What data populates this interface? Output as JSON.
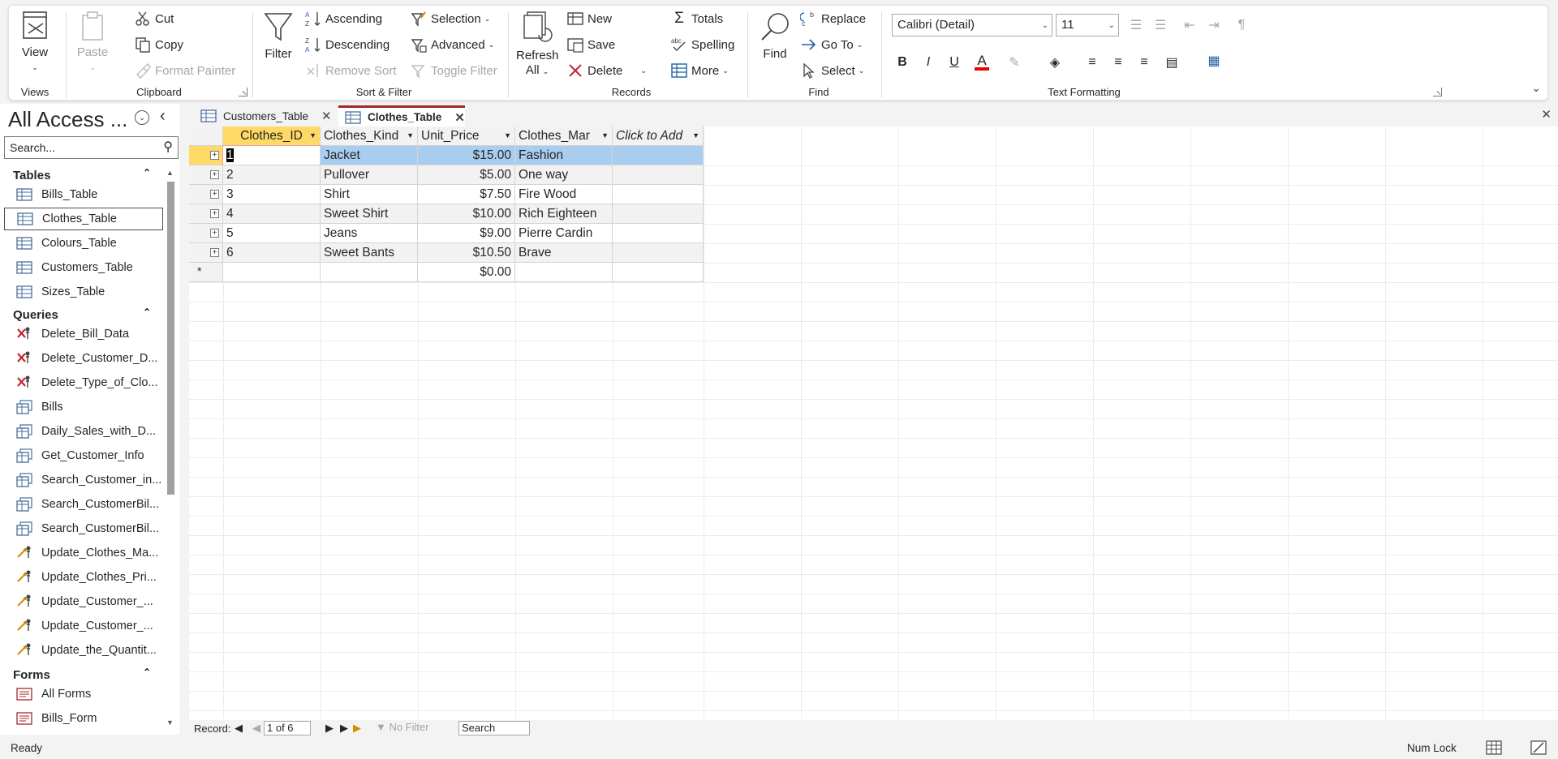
{
  "ribbon": {
    "views": {
      "view_label": "View",
      "group_label": "Views"
    },
    "clipboard": {
      "paste_label": "Paste",
      "cut_label": "Cut",
      "copy_label": "Copy",
      "format_painter_label": "Format Painter",
      "group_label": "Clipboard"
    },
    "sort_filter": {
      "filter_label": "Filter",
      "ascending_label": "Ascending",
      "descending_label": "Descending",
      "remove_sort_label": "Remove Sort",
      "selection_label": "Selection",
      "advanced_label": "Advanced",
      "toggle_filter_label": "Toggle Filter",
      "group_label": "Sort & Filter"
    },
    "records": {
      "refresh_label": "Refresh",
      "refresh_sub": "All",
      "new_label": "New",
      "save_label": "Save",
      "delete_label": "Delete",
      "totals_label": "Totals",
      "spelling_label": "Spelling",
      "more_label": "More",
      "group_label": "Records"
    },
    "find": {
      "find_label": "Find",
      "replace_label": "Replace",
      "goto_label": "Go To",
      "select_label": "Select",
      "group_label": "Find"
    },
    "text_formatting": {
      "font_value": "Calibri (Detail)",
      "size_value": "11",
      "bold": "B",
      "italic": "I",
      "underline": "U",
      "group_label": "Text Formatting"
    }
  },
  "nav": {
    "title": "All Access ...",
    "search_placeholder": "Search...",
    "sections": {
      "tables": {
        "label": "Tables",
        "items": [
          "Bills_Table",
          "Clothes_Table",
          "Colours_Table",
          "Customers_Table",
          "Sizes_Table"
        ]
      },
      "queries": {
        "label": "Queries",
        "items": [
          "Delete_Bill_Data",
          "Delete_Customer_D...",
          "Delete_Type_of_Clo...",
          "Bills",
          "Daily_Sales_with_D...",
          "Get_Customer_Info",
          "Search_Customer_in...",
          "Search_CustomerBil...",
          "Search_CustomerBil...",
          "Update_Clothes_Ma...",
          "Update_Clothes_Pri...",
          "Update_Customer_...",
          "Update_Customer_...",
          "Update_the_Quantit..."
        ]
      },
      "forms": {
        "label": "Forms",
        "items": [
          "All Forms",
          "Bills_Form"
        ]
      }
    },
    "selected_item": "Clothes_Table"
  },
  "tabs": [
    {
      "label": "Customers_Table",
      "active": false
    },
    {
      "label": "Clothes_Table",
      "active": true
    }
  ],
  "datasheet": {
    "columns": [
      "Clothes_ID",
      "Clothes_Kind",
      "Unit_Price",
      "Clothes_Mar",
      "Click to Add"
    ],
    "rows": [
      [
        "1",
        "Jacket",
        "$15.00",
        "Fashion"
      ],
      [
        "2",
        "Pullover",
        "$5.00",
        "One way"
      ],
      [
        "3",
        "Shirt",
        "$7.50",
        "Fire Wood"
      ],
      [
        "4",
        "Sweet Shirt",
        "$10.00",
        "Rich Eighteen"
      ],
      [
        "5",
        "Jeans",
        "$9.00",
        "Pierre Cardin"
      ],
      [
        "6",
        "Sweet Bants",
        "$10.50",
        "Brave"
      ]
    ],
    "new_row_price": "$0.00",
    "new_row_marker": "*"
  },
  "record_nav": {
    "label": "Record:",
    "position": "1 of 6",
    "filter_label": "No Filter",
    "search_label": "Search"
  },
  "status": {
    "text": "Ready",
    "numlock": "Num Lock"
  },
  "colors": {
    "accent": "#a4262c",
    "selection": "#a9cdef",
    "header_active": "#ffd966"
  }
}
